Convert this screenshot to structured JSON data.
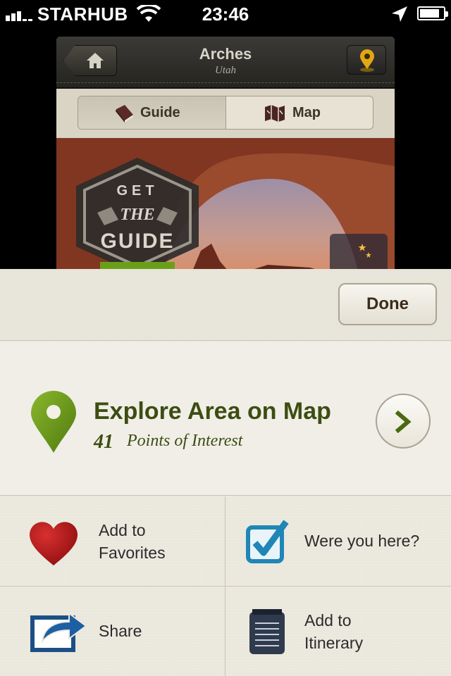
{
  "status_bar": {
    "carrier": "STARHUB",
    "time": "23:46",
    "signal_bars": 5,
    "signal_filled": 3,
    "battery_level": 0.85
  },
  "app": {
    "title": "Arches",
    "subtitle": "Utah",
    "home_icon": "home-icon",
    "map_pin_icon": "map-pin-icon",
    "segments": [
      {
        "label": "Guide",
        "icon": "book-icon",
        "selected": true
      },
      {
        "label": "Map",
        "icon": "folded-map-icon",
        "selected": false
      }
    ],
    "badge": {
      "line1": "GET",
      "line2": "THE",
      "line3": "GUIDE"
    },
    "night_icon": "moon-stars-icon"
  },
  "sheet": {
    "done_label": "Done",
    "explore": {
      "title": "Explore Area on Map",
      "count": "41",
      "subtitle": "Points of Interest"
    },
    "actions": [
      {
        "label": "Add to\nFavorites",
        "icon": "heart-icon"
      },
      {
        "label": "Were you here?",
        "icon": "checkbox-icon"
      },
      {
        "label": "Share",
        "icon": "share-arrow-icon"
      },
      {
        "label": "Add to\nItinerary",
        "icon": "notepad-icon"
      }
    ]
  },
  "colors": {
    "accent_green": "#3c4d12",
    "pin_green": "#6e9a1c",
    "heart_red": "#b01818",
    "check_blue": "#1f86b6"
  }
}
